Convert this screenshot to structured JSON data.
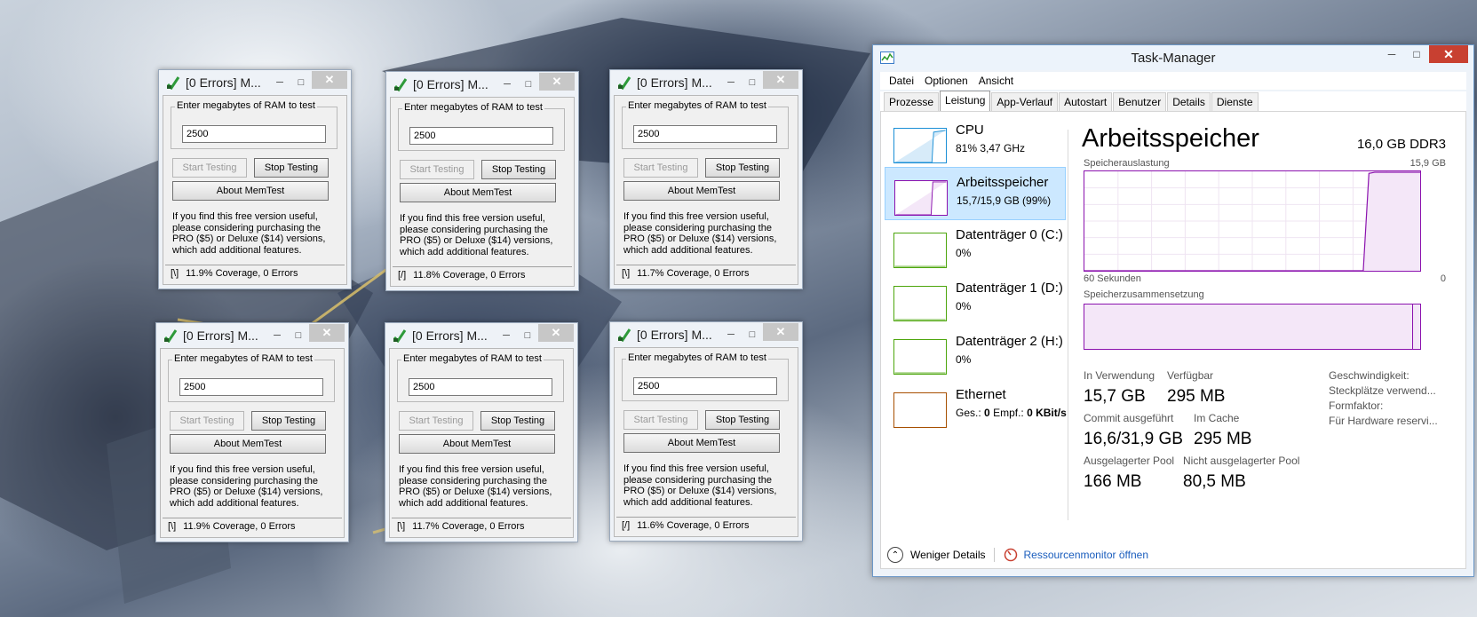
{
  "colors": {
    "memory_accent": "#8b12ae",
    "cpu_accent": "#1a8fd6",
    "disk_accent": "#4da60c",
    "ethernet_accent": "#a74f01",
    "selection": "#cce8ff",
    "close_red": "#c84031",
    "link": "#1a5dbd"
  },
  "memtest": {
    "group_label": "Enter megabytes of RAM to test",
    "start_label": "Start Testing",
    "stop_label": "Stop Testing",
    "about_label": "About MemTest",
    "info_text": "If you find this free version useful, please considering purchasing the PRO ($5) or Deluxe ($14) versions, which add additional features.",
    "windows": [
      {
        "title": "[0 Errors] M...",
        "value": "2500",
        "spinner": "[\\]",
        "status": "11.9% Coverage, 0 Errors"
      },
      {
        "title": "[0 Errors] M...",
        "value": "2500",
        "spinner": "[/]",
        "status": "11.8% Coverage, 0 Errors"
      },
      {
        "title": "[0 Errors] M...",
        "value": "2500",
        "spinner": "[\\]",
        "status": "11.7% Coverage, 0 Errors"
      },
      {
        "title": "[0 Errors] M...",
        "value": "2500",
        "spinner": "[\\]",
        "status": "11.9% Coverage, 0 Errors"
      },
      {
        "title": "[0 Errors] M...",
        "value": "2500",
        "spinner": "[\\]",
        "status": "11.7% Coverage, 0 Errors"
      },
      {
        "title": "[0 Errors] M...",
        "value": "2500",
        "spinner": "[/]",
        "status": "11.6% Coverage, 0 Errors"
      }
    ]
  },
  "taskmanager": {
    "title": "Task-Manager",
    "menu": [
      "Datei",
      "Optionen",
      "Ansicht"
    ],
    "tabs": [
      "Prozesse",
      "Leistung",
      "App-Verlauf",
      "Autostart",
      "Benutzer",
      "Details",
      "Dienste"
    ],
    "active_tab": "Leistung",
    "sidebar": [
      {
        "name": "CPU",
        "sub": "81% 3,47 GHz"
      },
      {
        "name": "Arbeitsspeicher",
        "sub": "15,7/15,9 GB (99%)"
      },
      {
        "name": "Datenträger 0 (C:)",
        "sub": "0%"
      },
      {
        "name": "Datenträger 1 (D:)",
        "sub": "0%"
      },
      {
        "name": "Datenträger 2 (H:)",
        "sub": "0%"
      },
      {
        "name": "Ethernet",
        "sub_ges_label": "Ges.:",
        "sub_ges_val": "0",
        "sub_empf_label": "Empf.:",
        "sub_empf_val": "0 KBit/s"
      }
    ],
    "main": {
      "title": "Arbeitsspeicher",
      "spec": "16,0 GB DDR3",
      "usage_label": "Speicherauslastung",
      "usage_max": "15,9 GB",
      "time_label": "60 Sekunden",
      "time_end": "0",
      "composition_label": "Speicherzusammensetzung",
      "usage_history": [
        0,
        0,
        0,
        0,
        0,
        0,
        0,
        0,
        0,
        0,
        0,
        0,
        0,
        0,
        0,
        0,
        0,
        0,
        0,
        0,
        0,
        0,
        0,
        0,
        0,
        0,
        0,
        0,
        0,
        0,
        0,
        0,
        0,
        0,
        0,
        0,
        0,
        0,
        0,
        0,
        0,
        0,
        0,
        0,
        0,
        0,
        0,
        0,
        0,
        0,
        0.98,
        0.99,
        0.99,
        0.99,
        0.99,
        0.99,
        0.99,
        0.99,
        0.99,
        0.99
      ],
      "stats": [
        {
          "label": "In Verwendung",
          "value": "15,7 GB"
        },
        {
          "label": "Verfügbar",
          "value": "295 MB"
        },
        {
          "label": "Commit ausgeführt",
          "value": "16,6/31,9 GB"
        },
        {
          "label": "Im Cache",
          "value": "295 MB"
        },
        {
          "label": "Ausgelagerter Pool",
          "value": "166 MB"
        },
        {
          "label": "Nicht ausgelagerter Pool",
          "value": "80,5 MB"
        }
      ],
      "right_labels": [
        "Geschwindigkeit:",
        "Steckplätze verwend...",
        "Formfaktor:",
        "Für Hardware reservi..."
      ]
    },
    "footer": {
      "fewer_details": "Weniger Details",
      "resource_monitor": "Ressourcenmonitor öffnen"
    }
  }
}
